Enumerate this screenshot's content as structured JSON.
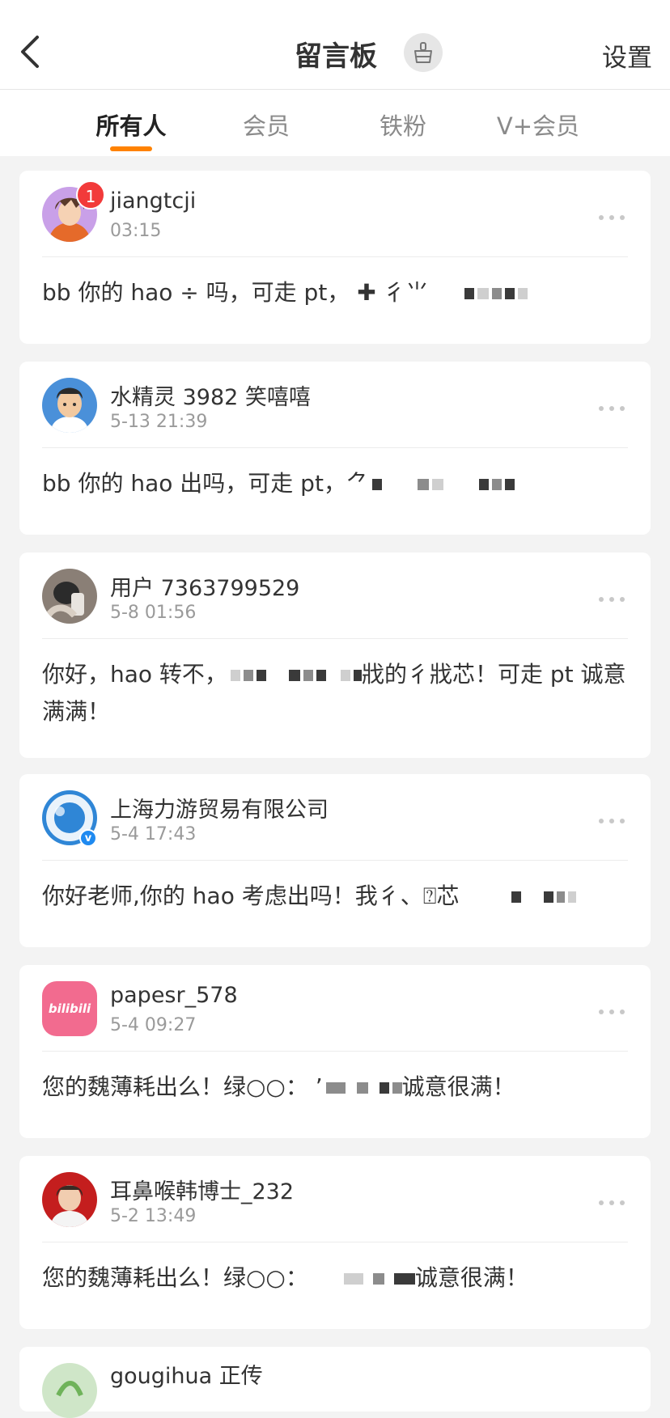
{
  "header": {
    "title": "留言板",
    "settings_label": "设置"
  },
  "tabs": [
    {
      "label": "所有人",
      "active": true
    },
    {
      "label": "会员",
      "active": false
    },
    {
      "label": "铁粉",
      "active": false
    },
    {
      "label": "V+会员",
      "active": false
    }
  ],
  "accent_color": "#ff8200",
  "messages": [
    {
      "username": "jiangtcji",
      "time": "03:15",
      "badge": "1",
      "text": "bb 你的 hao ÷ 吗，可走 pt， ✚ 彳⺌"
    },
    {
      "username": "水精灵 3982 笑嘻嘻",
      "time": "5-13 21:39",
      "text": "bb 你的 hao 出吗，可走 pt，⺈"
    },
    {
      "username": "用户 7363799529",
      "time": "5-8 01:56",
      "text_a": "你好，hao 转不，",
      "text_b": "戕的彳戕芯！可走 pt  诚意满满！"
    },
    {
      "username": "上海力游贸易有限公司",
      "time": "5-4 17:43",
      "verified_label": "v",
      "text": "你好老师,你的 hao 考虑出吗！我彳、⍰芯"
    },
    {
      "username": "papesr_578",
      "time": "5-4 09:27",
      "avatar_text": "bilibili",
      "text_a": "您的魏薄耗出么！绿○○：  ’",
      "text_b": "诚意很满！"
    },
    {
      "username": "耳鼻喉韩博士_232",
      "time": "5-2 13:49",
      "text_a": "您的魏薄耗出么！绿○○：",
      "text_b": "诚意很满！"
    },
    {
      "username": "gougihua 正传"
    }
  ]
}
